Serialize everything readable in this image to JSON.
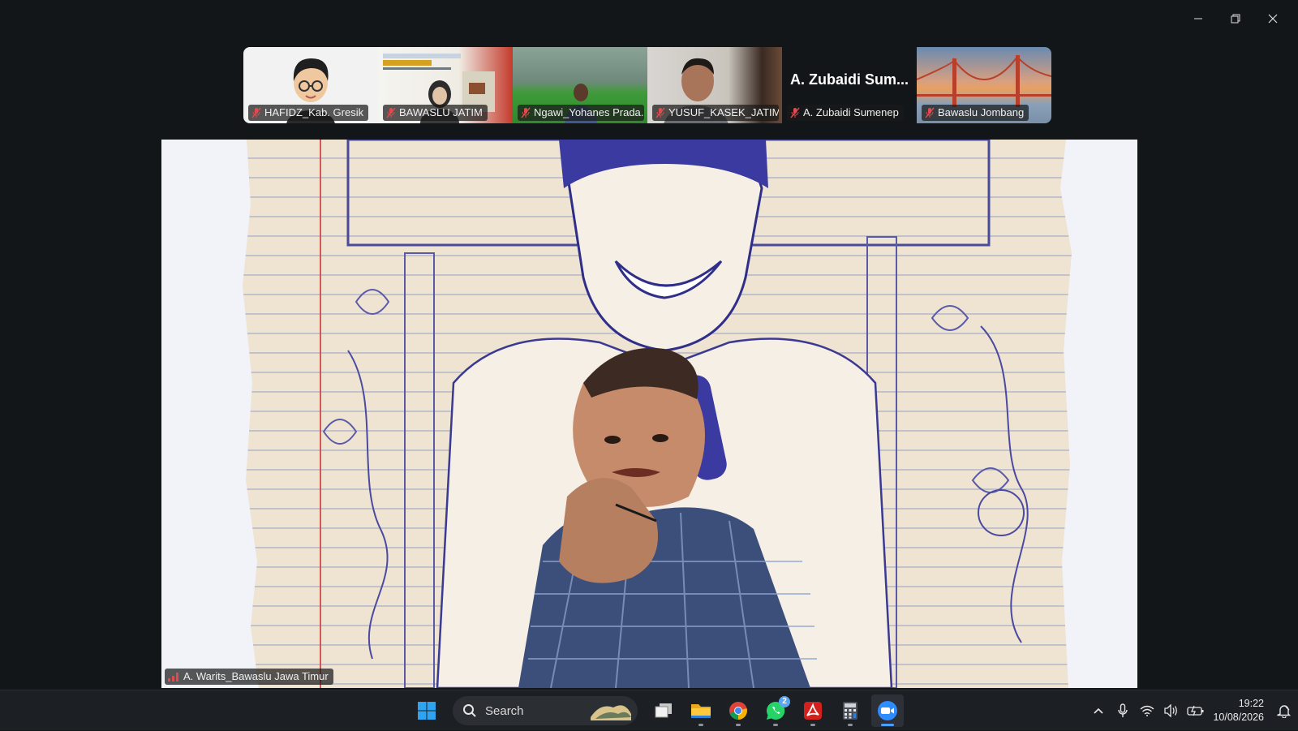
{
  "window": {
    "controls": {
      "minimize": "minimize-icon",
      "restore": "restore-icon",
      "close": "close-icon"
    }
  },
  "participants": [
    {
      "name": "HAFIDZ_Kab. Gresik",
      "muted": true,
      "video": "memoji-avatar"
    },
    {
      "name": "BAWASLU JATIM",
      "muted": true,
      "video": "virtual-background-banner"
    },
    {
      "name": "Ngawi_Yohanes Prada...",
      "muted": true,
      "video": "outdoor-green-field"
    },
    {
      "name": "YUSUF_KASEK_JATIM",
      "muted": true,
      "video": "indoor-camera"
    },
    {
      "name": "A. Zubaidi Sumenep",
      "muted": true,
      "video": "none",
      "display_name": "A. Zubaidi Sum..."
    },
    {
      "name": "Bawaslu Jombang",
      "muted": true,
      "video": "golden-gate-bridge"
    }
  ],
  "main_speaker": {
    "name": "A. Warits_Bawaslu Jawa Timur",
    "signal_icon": "signal-bars-icon",
    "video": "speaker-with-sketch-background"
  },
  "taskbar": {
    "search_placeholder": "Search",
    "apps": [
      {
        "name": "start",
        "icon": "windows-logo-icon"
      },
      {
        "name": "task-view",
        "icon": "task-view-icon"
      },
      {
        "name": "file-explorer",
        "icon": "folder-icon"
      },
      {
        "name": "chrome",
        "icon": "chrome-icon"
      },
      {
        "name": "whatsapp",
        "icon": "whatsapp-icon",
        "badge": "2"
      },
      {
        "name": "acrobat",
        "icon": "acrobat-icon"
      },
      {
        "name": "calculator",
        "icon": "calculator-icon"
      },
      {
        "name": "zoom",
        "icon": "zoom-icon",
        "active": true
      }
    ],
    "time": "19:22",
    "date": "10/08/2026"
  },
  "colors": {
    "window_bg": "#131619",
    "taskbar_bg": "#1c1f24",
    "accent": "#4aa0ff",
    "muted_red": "#e5484d"
  }
}
